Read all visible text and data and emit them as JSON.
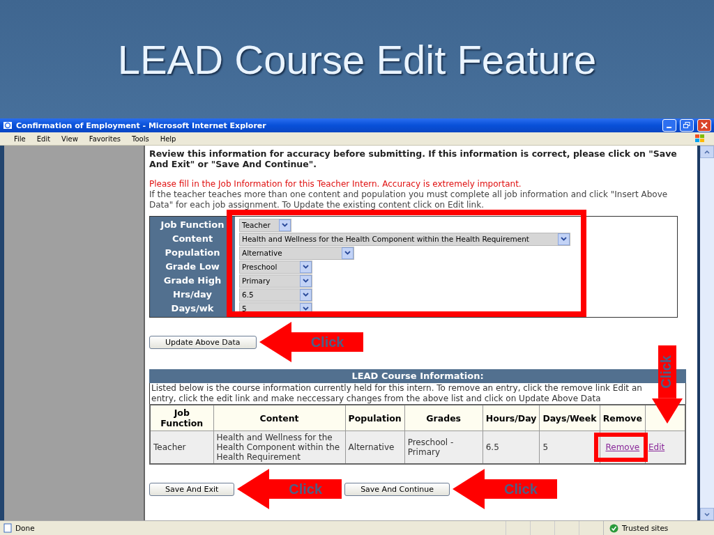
{
  "slide": {
    "title": "LEAD Course Edit Feature"
  },
  "window": {
    "title": "Confirmation of Employment - Microsoft Internet Explorer",
    "menu": [
      "File",
      "Edit",
      "View",
      "Favorites",
      "Tools",
      "Help"
    ]
  },
  "page": {
    "intro": "Review this information for accuracy before submitting. If this information is correct, please click on \"Save And Exit\" or \"Save And Continue\".",
    "notice": "Please fill in the Job Information for this Teacher Intern. Accuracy is extremely important.",
    "instructions": "If the teacher teaches more than one content and population you must complete all job information and click \"Insert Above Data\" for each job assignment. To Update the existing content click on Edit link.",
    "form": [
      {
        "label": "Job Function",
        "value": "Teacher"
      },
      {
        "label": "Content",
        "value": "Health and Wellness for the Health Component within the Health Requirement"
      },
      {
        "label": "Population",
        "value": "Alternative"
      },
      {
        "label": "Grade Low",
        "value": "Preschool"
      },
      {
        "label": "Grade High",
        "value": "Primary"
      },
      {
        "label": "Hrs/day",
        "value": "6.5"
      },
      {
        "label": "Days/wk",
        "value": "5"
      }
    ],
    "update_button": "Update Above Data",
    "course_info": {
      "title": "LEAD Course Information:",
      "description": "Listed below is the course information currently held for this intern. To remove an entry, click the remove link Edit an entry, click the edit link and make neccessary changes from the above list and click on Update Above Data",
      "columns": [
        "Job Function",
        "Content",
        "Population",
        "Grades",
        "Hours/Day",
        "Days/Week",
        "Remove"
      ],
      "rows": [
        {
          "cells": [
            "Teacher",
            "Health and Wellness for the Health Component within the Health Requirement",
            "Alternative",
            "Preschool - Primary",
            "6.5",
            "5"
          ],
          "remove_link": "Remove",
          "edit_link": "Edit"
        }
      ]
    },
    "buttons": [
      "Save And Exit",
      "Save And Continue"
    ]
  },
  "annotations": [
    {
      "kind": "arrow-left",
      "label": "Click"
    },
    {
      "kind": "arrow-down",
      "label": "Click"
    },
    {
      "kind": "arrow-left",
      "label": "Click"
    },
    {
      "kind": "arrow-left",
      "label": "Click"
    }
  ],
  "status_bar": {
    "text": "Done",
    "zone": "Trusted sites"
  }
}
